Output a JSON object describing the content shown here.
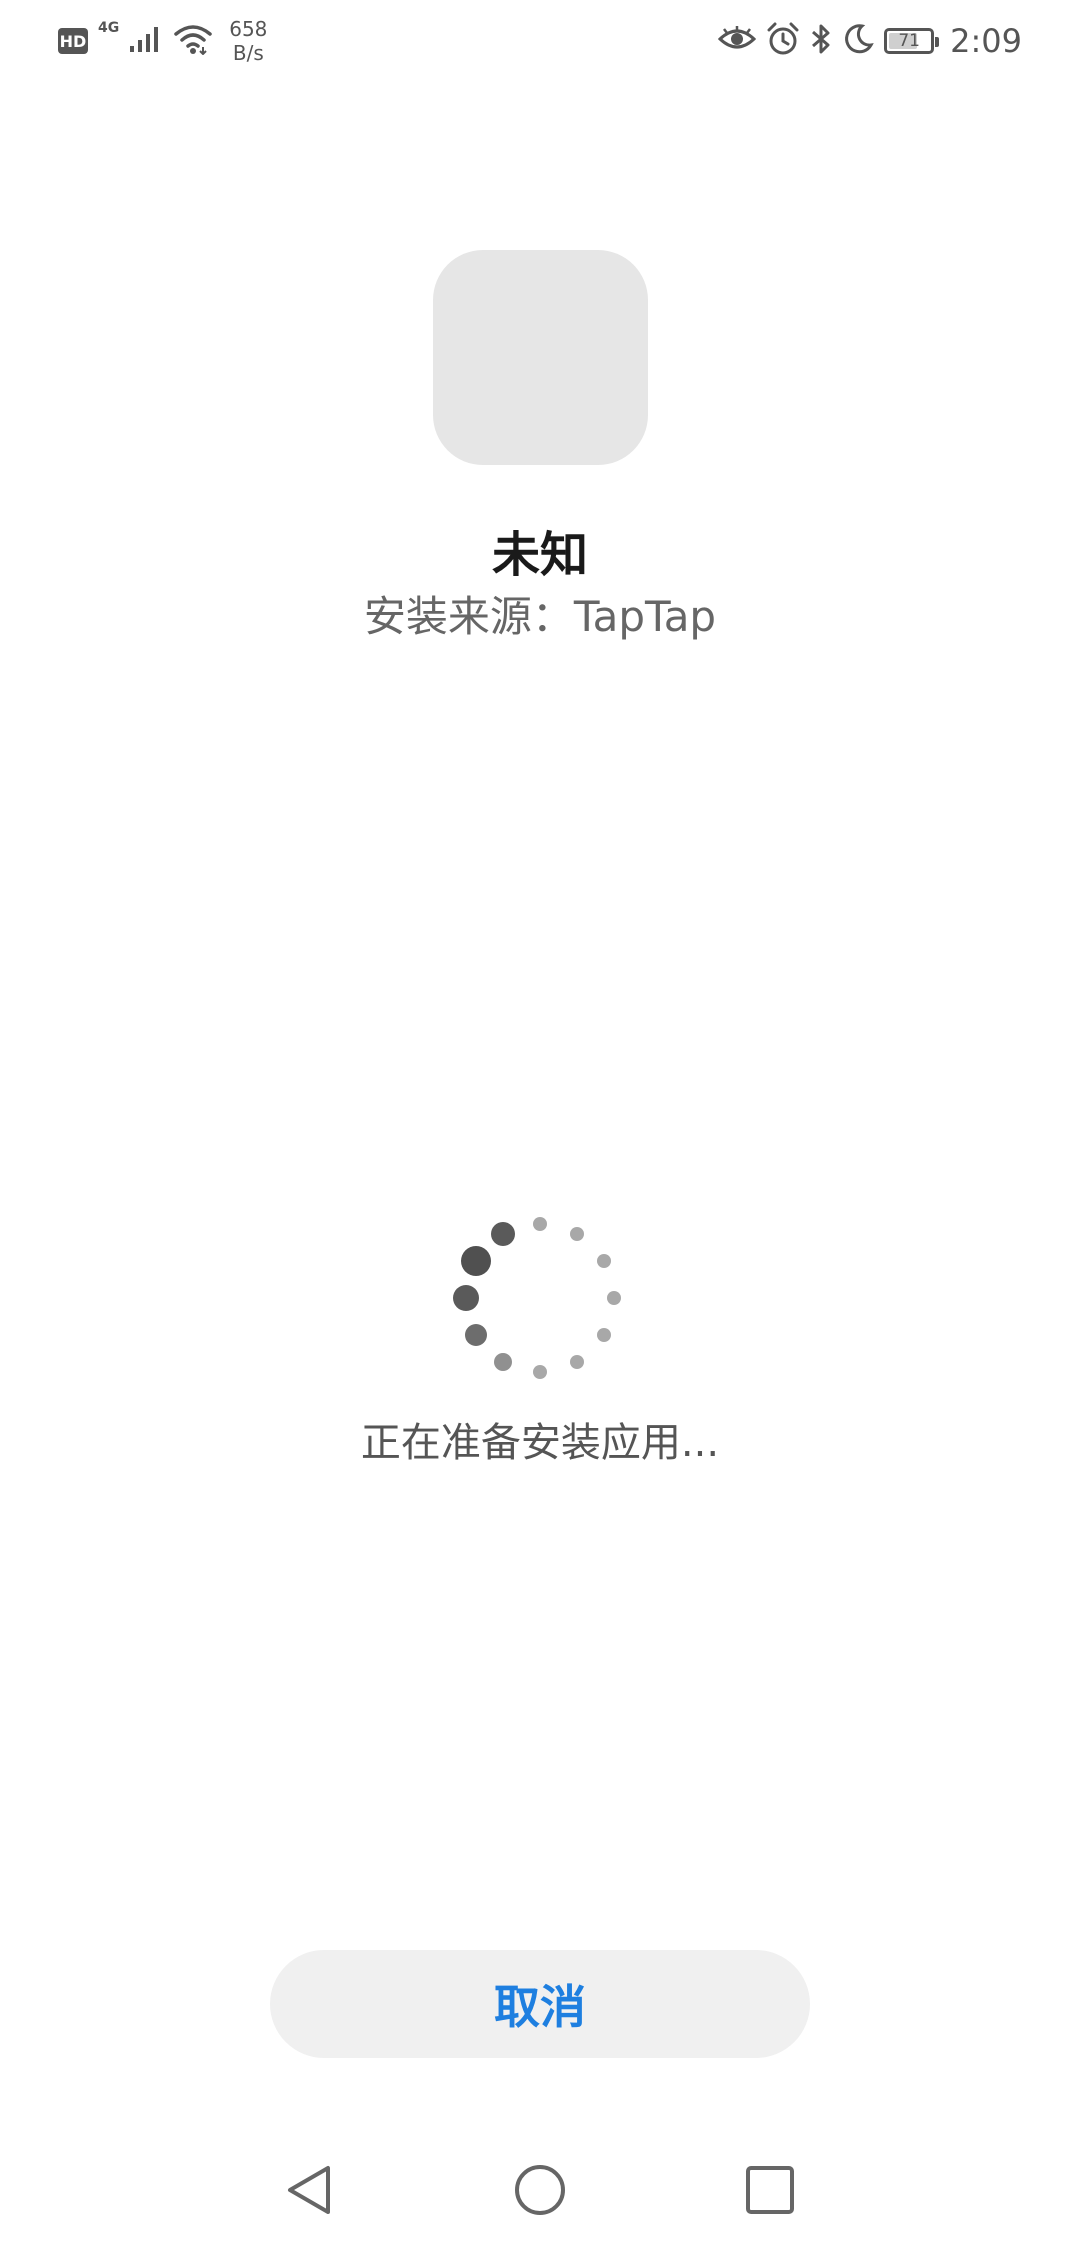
{
  "status_bar": {
    "hd": "HD",
    "network_type": "4G",
    "speed_value": "658",
    "speed_unit": "B/s",
    "battery": "71",
    "battery_level": 0.71,
    "time": "2:09",
    "icons": [
      "hd-icon",
      "signal-icon",
      "wifi-icon",
      "eye-comfort-icon",
      "alarm-icon",
      "bluetooth-icon",
      "do-not-disturb-icon",
      "battery-icon"
    ]
  },
  "app": {
    "name": "未知",
    "source": "安装来源：TapTap"
  },
  "progress": {
    "status_text": "正在准备安装应用..."
  },
  "actions": {
    "cancel_label": "取消"
  },
  "colors": {
    "accent": "#1e7fe0",
    "icon_placeholder": "#e6e6e6",
    "button_bg": "#f0f0f0",
    "secondary_text": "#666666"
  },
  "nav_bar": {
    "icons": [
      "back-icon",
      "home-icon",
      "recents-icon"
    ]
  }
}
